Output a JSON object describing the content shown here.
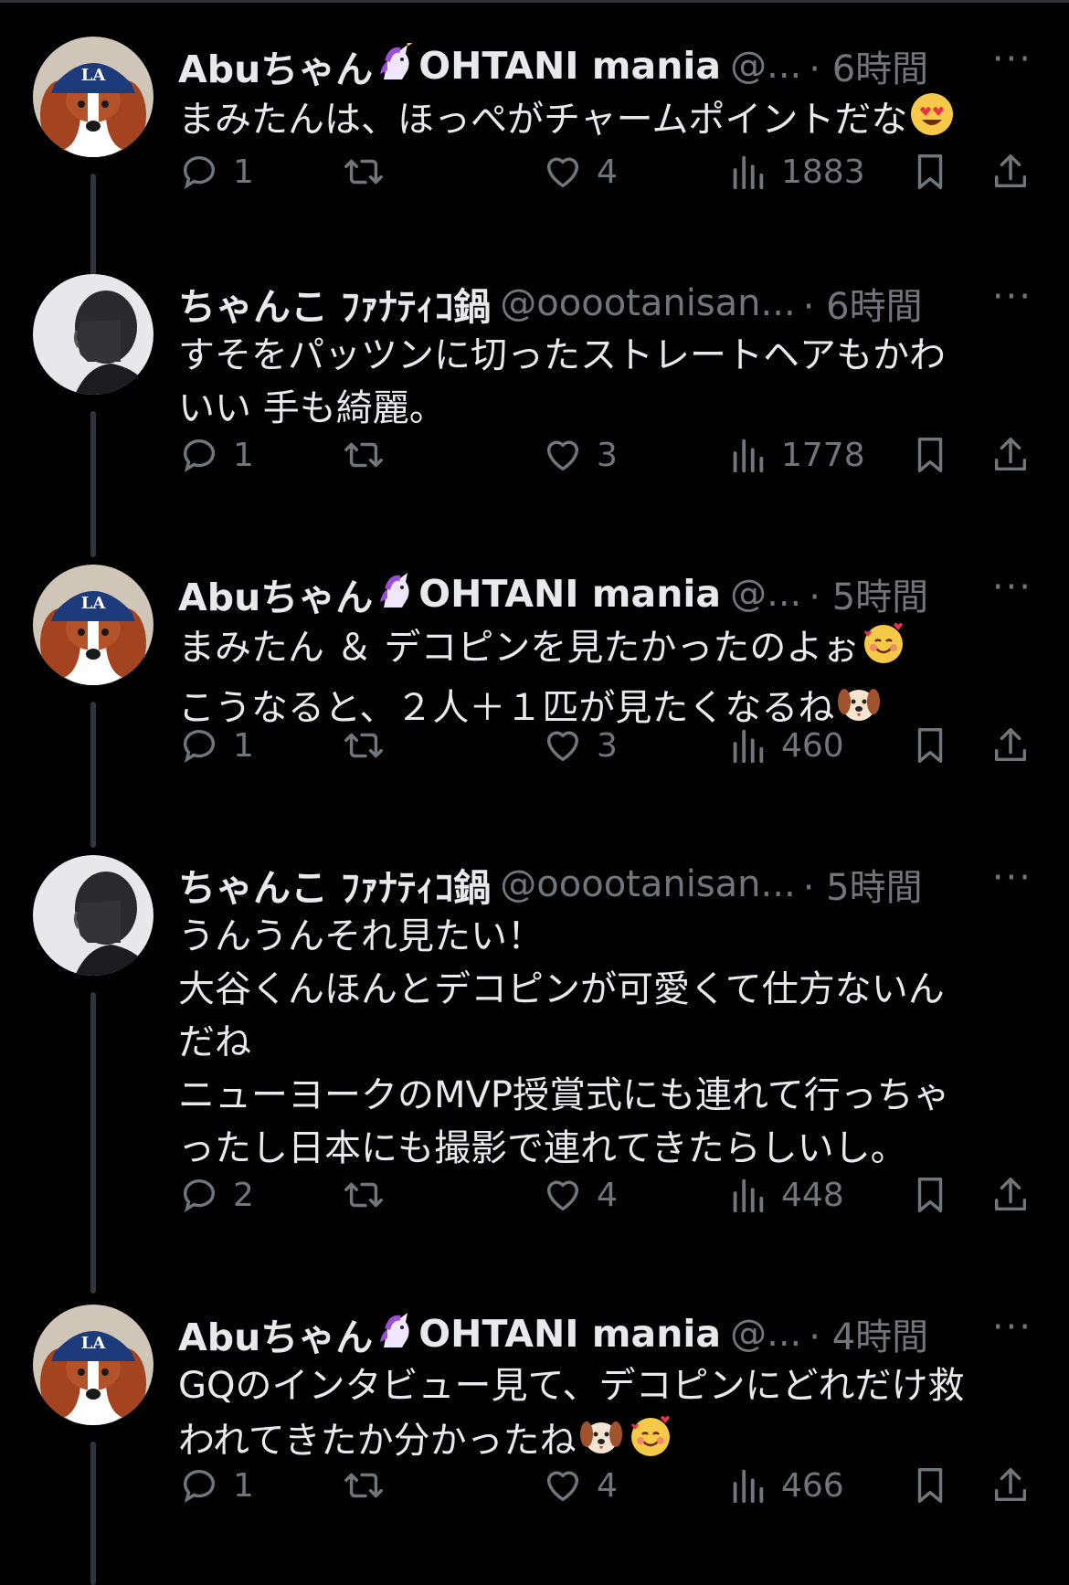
{
  "tweets": [
    {
      "name": "Abuちゃん",
      "name_suffix": "OHTANI mania",
      "handle": "@...",
      "time": "· 6時間",
      "more": "···",
      "lines": [
        "まみたんは、ほっぺがチャームポイントだな"
      ],
      "replies": "1",
      "retweets": "",
      "likes": "4",
      "views": "1883",
      "avatar": "dog-avatar"
    },
    {
      "name": "ちゃんこ ﾌｧﾅﾃｨｺ鍋",
      "name_suffix": "",
      "handle": "@ooootanisan...",
      "time": "· 6時間",
      "more": "···",
      "lines": [
        "すそをパッツンに切ったストレートヘアもかわ",
        "いい 手も綺麗。"
      ],
      "replies": "1",
      "retweets": "",
      "likes": "3",
      "views": "1778",
      "avatar": "person-avatar"
    },
    {
      "name": "Abuちゃん",
      "name_suffix": "OHTANI mania",
      "handle": "@...",
      "time": "· 5時間",
      "more": "···",
      "lines": [
        "まみたん ＆ デコピンを見たかったのよぉ",
        "こうなると、２人＋１匹が見たくなるね"
      ],
      "replies": "1",
      "retweets": "",
      "likes": "3",
      "views": "460",
      "avatar": "dog-avatar"
    },
    {
      "name": "ちゃんこ ﾌｧﾅﾃｨｺ鍋",
      "name_suffix": "",
      "handle": "@ooootanisan...",
      "time": "· 5時間",
      "more": "···",
      "lines": [
        "うんうんそれ見たい！",
        "大谷くんほんとデコピンが可愛くて仕方ないん",
        "だね",
        "ニューヨークのMVP授賞式にも連れて行っちゃ",
        "ったし日本にも撮影で連れてきたらしいし。"
      ],
      "replies": "2",
      "retweets": "",
      "likes": "4",
      "views": "448",
      "avatar": "person-avatar"
    },
    {
      "name": "Abuちゃん",
      "name_suffix": "OHTANI mania",
      "handle": "@...",
      "time": "· 4時間",
      "more": "···",
      "lines": [
        "GQのインタビュー見て、デコピンにどれだけ救",
        "われてきたか分かったね"
      ],
      "replies": "1",
      "retweets": "",
      "likes": "4",
      "views": "466",
      "avatar": "dog-avatar"
    }
  ],
  "colors": {
    "background": "#000000",
    "text": "#e7e9ea",
    "muted": "#71767b",
    "thread": "#333639"
  }
}
